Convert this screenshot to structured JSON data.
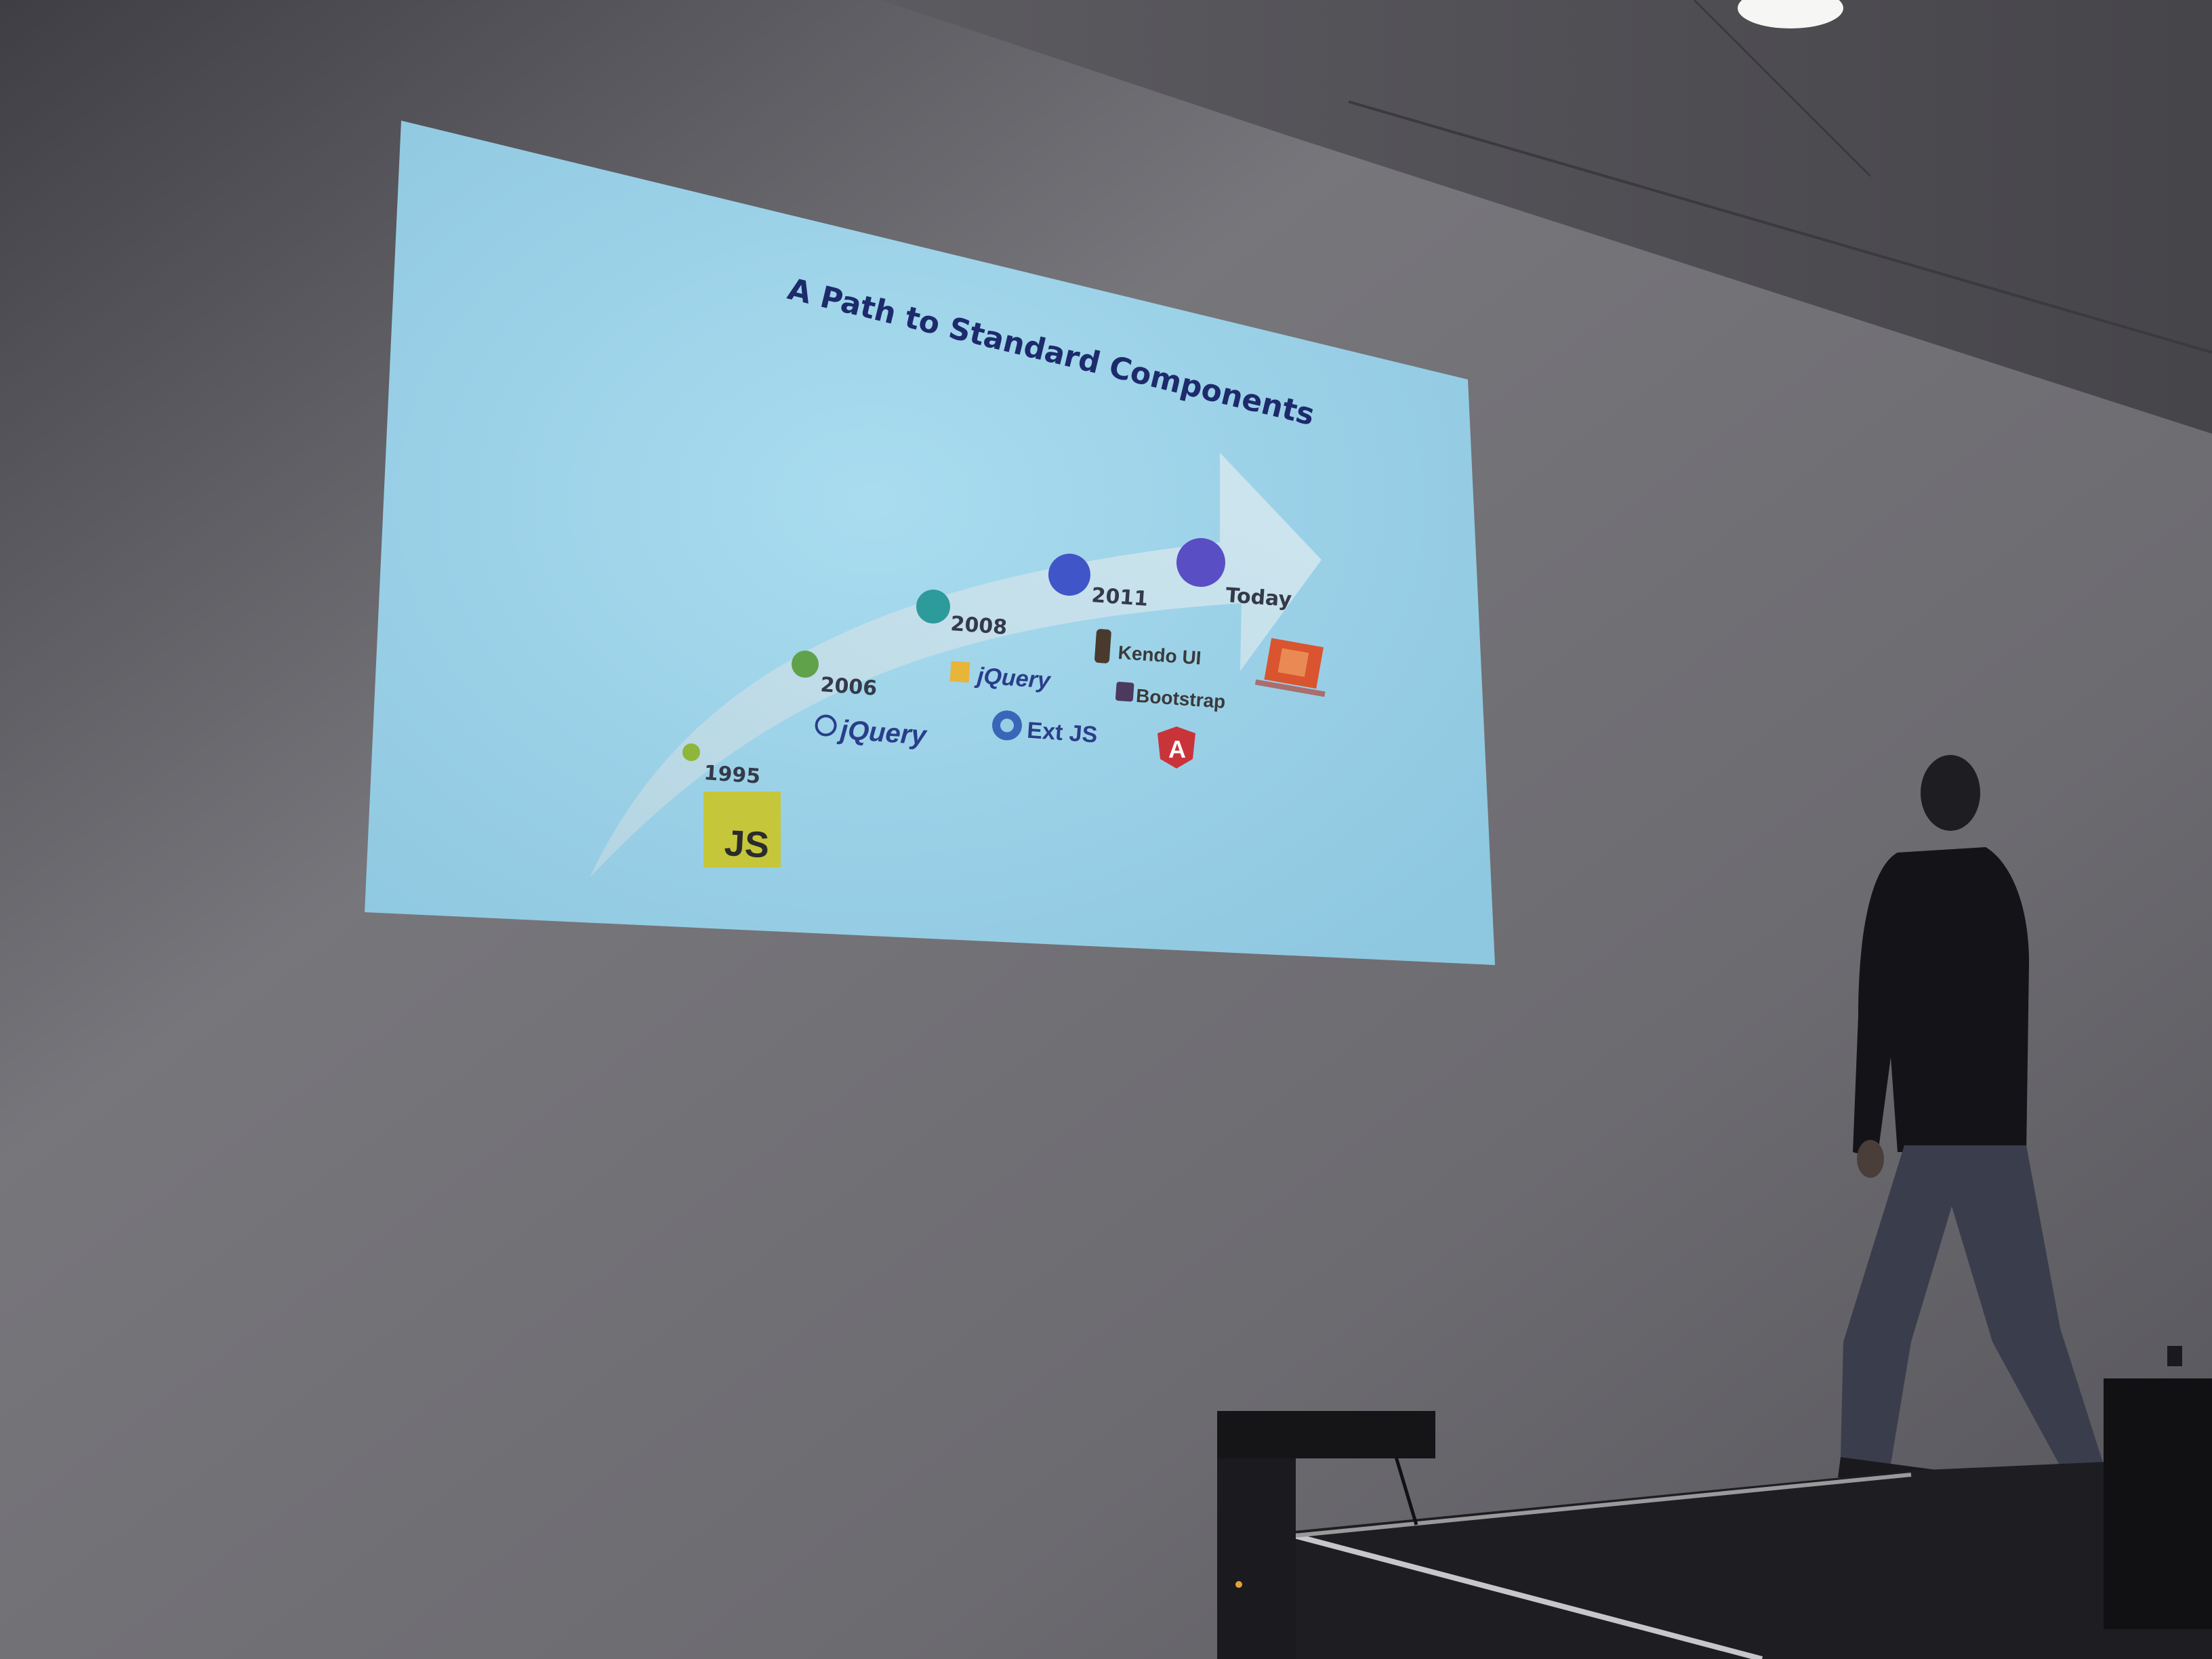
{
  "slide": {
    "title": "A Path to Standard Components",
    "milestones": [
      {
        "year": "1995",
        "color": "#8fb53a"
      },
      {
        "year": "2006",
        "color": "#5fa24a"
      },
      {
        "year": "2008",
        "color": "#2d9a9c"
      },
      {
        "year": "2011",
        "color": "#3f55c8"
      },
      {
        "year": "Today",
        "color": "#5a4ec4"
      }
    ],
    "logos": {
      "js": "JS",
      "jquery": "jQuery",
      "jquery_ui": "jQuery",
      "extjs": "Ext JS",
      "kendo": "Kendo UI",
      "bootstrap": "Bootstrap",
      "angular": "A"
    }
  },
  "colors": {
    "wall": "#6e6d72",
    "slide_bg": "#97cee4",
    "arrow": "#c9e0ea",
    "title": "#1d2a6b"
  }
}
